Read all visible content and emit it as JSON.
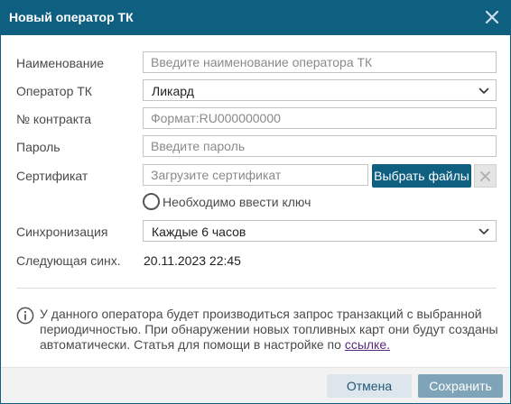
{
  "dialog": {
    "title": "Новый оператор ТК"
  },
  "form": {
    "name": {
      "label": "Наименование",
      "value": "",
      "placeholder": "Введите наименование оператора ТК"
    },
    "operator": {
      "label": "Оператор ТК",
      "selected": "Ликард"
    },
    "contract": {
      "label": "№ контракта",
      "value": "",
      "placeholder": "Формат:RU000000000"
    },
    "password": {
      "label": "Пароль",
      "value": "",
      "placeholder": "Введите пароль"
    },
    "certificate": {
      "label": "Сертификат",
      "value": "",
      "placeholder": "Загрузите сертификат",
      "choose_files_label": "Выбрать файлы"
    },
    "key_required": {
      "label": "Необходимо ввести ключ",
      "checked": false
    },
    "sync": {
      "label": "Синхронизация",
      "selected": "Каждые 6 часов"
    },
    "next_sync": {
      "label": "Следующая синх.",
      "value": "20.11.2023 22:45"
    }
  },
  "info": {
    "text": "У данного оператора будет производиться запрос транзакций с выбранной периодичностью. При обнаружении новых топливных карт они будут созданы автоматически. Статья для помощи в настройке по ",
    "link_text": "ссылке."
  },
  "footer": {
    "cancel_label": "Отмена",
    "save_label": "Сохранить"
  },
  "colors": {
    "header": "#0e5f80",
    "primary_button": "#0e5f80",
    "save_button_disabled": "#7fa4b8",
    "cancel_button": "#dde6ec",
    "link": "#5a2a7a"
  }
}
